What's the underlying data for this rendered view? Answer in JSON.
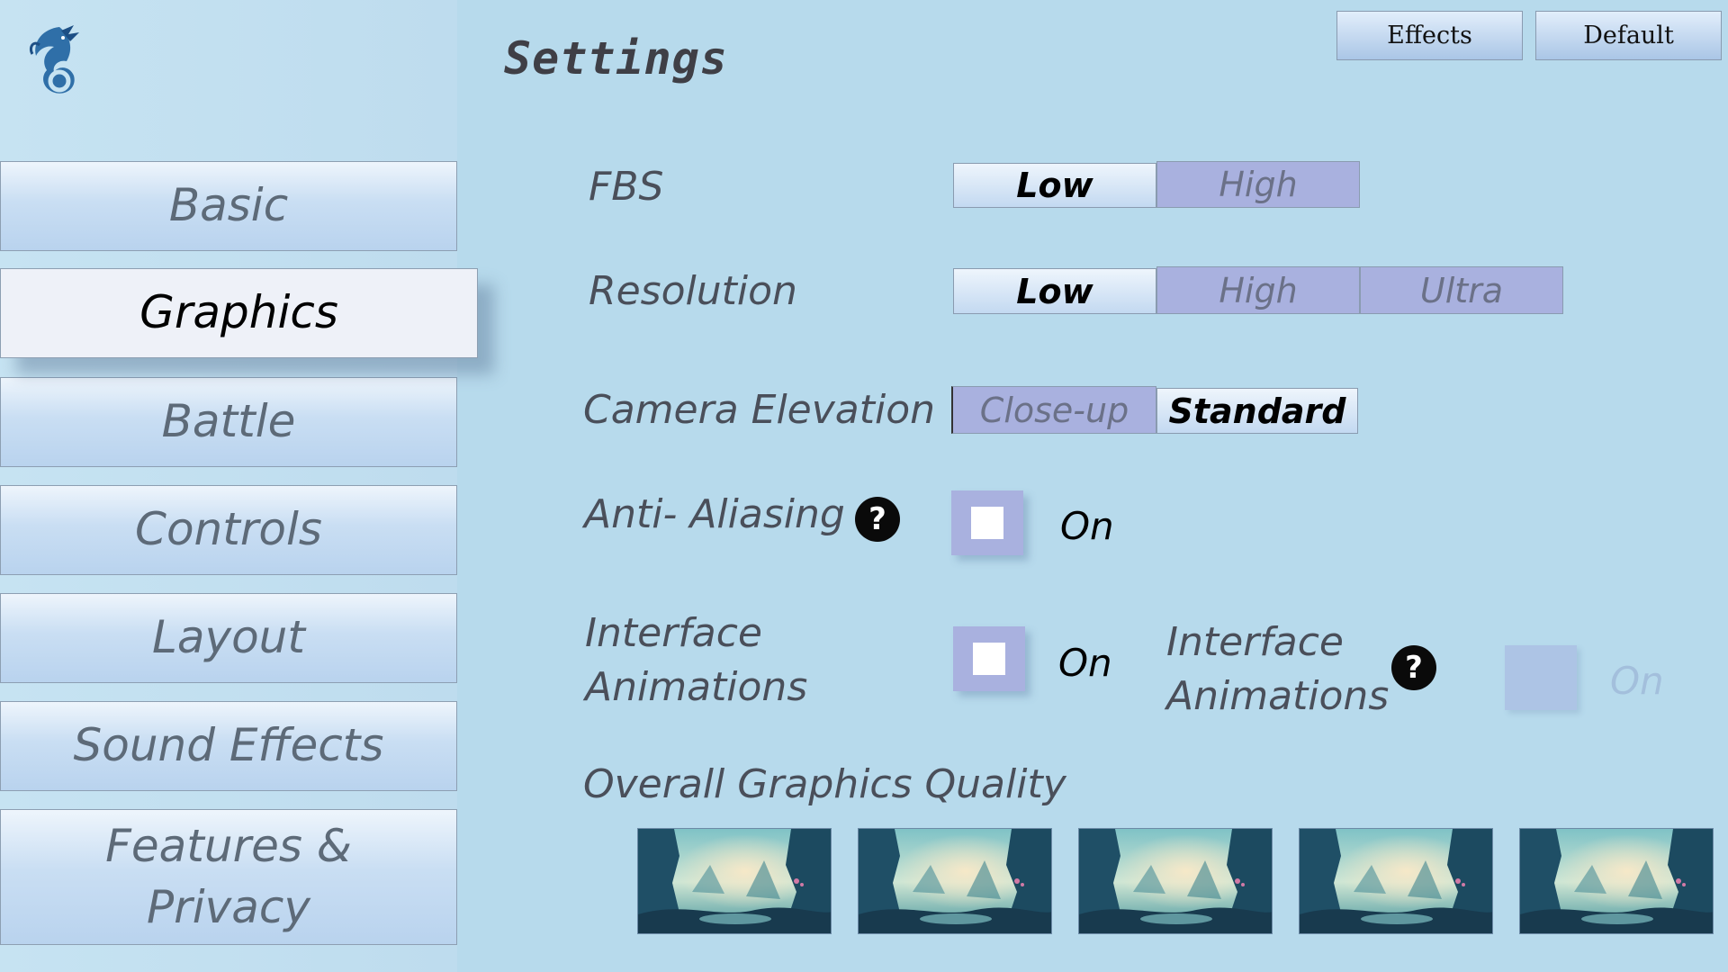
{
  "header": {
    "title": "Settings",
    "effects_label": "Effects",
    "default_label": "Default"
  },
  "sidebar": {
    "items": [
      {
        "label": "Basic"
      },
      {
        "label": "Graphics",
        "active": true
      },
      {
        "label": "Battle"
      },
      {
        "label": "Controls"
      },
      {
        "label": "Layout"
      },
      {
        "label": "Sound Effects"
      },
      {
        "label": "Features & Privacy"
      }
    ]
  },
  "settings": {
    "fbs": {
      "label": "FBS",
      "options": [
        "Low",
        "High"
      ],
      "selected": "Low"
    },
    "resolution": {
      "label": "Resolution",
      "options": [
        "Low",
        "High",
        "Ultra"
      ],
      "selected": "Low"
    },
    "camera": {
      "label": "Camera Elevation",
      "options": [
        "Close-up",
        "Standard"
      ],
      "selected": "Standard"
    },
    "anti_aliasing": {
      "label": "Anti- Aliasing",
      "help": "?",
      "on_label": "On",
      "checked": false
    },
    "interface_animations": {
      "label_line1": "Interface",
      "label_line2": "Animations",
      "on_label": "On",
      "checked": false
    },
    "interface_animations_2": {
      "label_line1": "Interface",
      "label_line2": "Animations",
      "help": "?",
      "on_label": "On",
      "disabled": true
    },
    "overall_quality": {
      "label": "Overall Graphics Quality",
      "thumbnail_count": 5
    }
  },
  "colors": {
    "background": "#b7daec",
    "selected_segment": "#c3d9f1",
    "unselected_segment": "#a9b1df",
    "logo": "#2f6fa8"
  },
  "icons": {
    "logo": "dragon-logo-icon",
    "help": "question-mark-icon",
    "thumbnail": "forest-landscape-image"
  }
}
